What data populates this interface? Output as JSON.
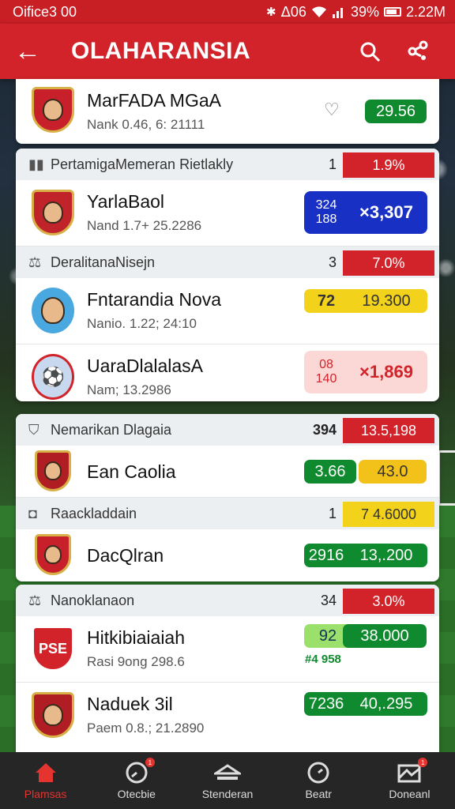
{
  "status_bar": {
    "time": "Oifice3 00",
    "network": "ᐃ06",
    "battery": "39%",
    "clock": "2.22M"
  },
  "app_bar": {
    "title": "OLAHARANSIA"
  },
  "colors": {
    "accent": "#d2232a",
    "green": "#108a2e",
    "blue": "#1930c4",
    "yellow": "#f2d21b"
  },
  "top_card": {
    "name": "MarFADA MGaA",
    "sub": "Nank 0.46, 6: 21111",
    "score": "29.56"
  },
  "card1": {
    "sections": [
      {
        "title": "PertamigaMemeran Rietlakly",
        "count": "1",
        "pct": "1.9%",
        "rows": [
          {
            "name": "YarlaBaol",
            "sub": "Nand 1.7+ 25.2286",
            "pill_small": "324\n188",
            "pill_main": "×3,307"
          }
        ]
      },
      {
        "title": "DeralitanaNisejn",
        "count": "3",
        "pct": "7.0%",
        "rows": [
          {
            "name": "Fntarandia Nova",
            "sub": "Nanio. 1.22; 24:10",
            "pill_small": "72",
            "pill_main": "19.300"
          },
          {
            "name": "UaraDlalalasA",
            "sub": "Nam; 13.2986",
            "pill_small": "08\n140",
            "pill_main": "×1,869"
          }
        ]
      }
    ]
  },
  "card2": {
    "sections": [
      {
        "title": "Nemarikan Dlagaia",
        "count": "394",
        "pct": "13.5,198",
        "rows": [
          {
            "name": "Ean Caolia",
            "pill_small": "3.66",
            "pill_main": "43.0"
          }
        ]
      },
      {
        "title": "Raackladdain",
        "count": "1",
        "pct": "7 4.6000",
        "rows": [
          {
            "name": "DacQlran",
            "pill_small": "2916",
            "pill_main": "13,.200"
          }
        ]
      }
    ]
  },
  "card3": {
    "sections": [
      {
        "title": "Nanoklanaon",
        "count": "34",
        "pct": "3.0%",
        "rows": [
          {
            "name": "Hitkibiaiaiah",
            "sub": "Rasi 9ong 298.6",
            "pill_small": "92",
            "pill_main": "38.000",
            "extra": "#4 958"
          },
          {
            "name": "Naduek 3il",
            "sub": "Paem 0.8.; 21.2890",
            "pill_small": "7236",
            "pill_main": "40,.295"
          }
        ]
      }
    ]
  },
  "bottom_nav": [
    {
      "label": "Plamsas",
      "icon": "home-icon",
      "active": true
    },
    {
      "label": "Otecbie",
      "icon": "gauge-icon",
      "badge": "1"
    },
    {
      "label": "Stenderan",
      "icon": "stadium-icon"
    },
    {
      "label": "Beatr",
      "icon": "clock-icon"
    },
    {
      "label": "Doneanl",
      "icon": "mail-icon",
      "badge": "1"
    }
  ]
}
